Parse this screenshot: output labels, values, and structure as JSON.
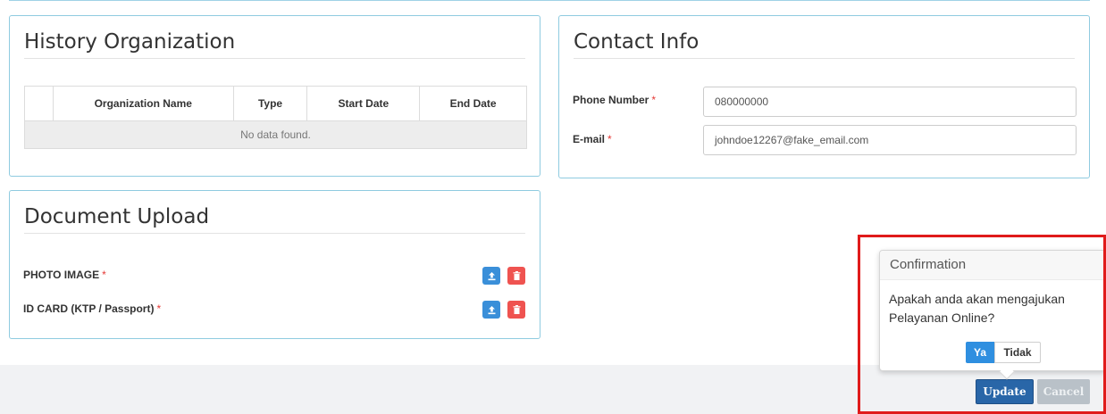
{
  "history": {
    "title": "History Organization",
    "columns": [
      "",
      "Organization Name",
      "Type",
      "Start Date",
      "End Date"
    ],
    "empty_message": "No data found."
  },
  "contact": {
    "title": "Contact Info",
    "phone_label": "Phone Number",
    "phone_value": "080000000",
    "email_label": "E-mail",
    "email_value": "johndoe12267@fake_email.com",
    "required_mark": "*"
  },
  "documents": {
    "title": "Document Upload",
    "items": [
      {
        "label": "PHOTO IMAGE",
        "upload_icon": "upload-icon",
        "delete_icon": "trash-icon"
      },
      {
        "label": "ID CARD (KTP / Passport)",
        "upload_icon": "upload-icon",
        "delete_icon": "trash-icon"
      }
    ]
  },
  "confirmation": {
    "title": "Confirmation",
    "message": "Apakah anda akan mengajukan Pelayanan Online?",
    "yes_label": "Ya",
    "no_label": "Tidak"
  },
  "footer": {
    "update_label": "Update",
    "cancel_label": "Cancel"
  },
  "colors": {
    "panel_border": "#8fcbe0",
    "primary": "#2966a8",
    "upload_blue": "#3a8fd9",
    "delete_red": "#ef5350",
    "required_red": "#e53935",
    "highlight_red": "#e01b1b"
  }
}
